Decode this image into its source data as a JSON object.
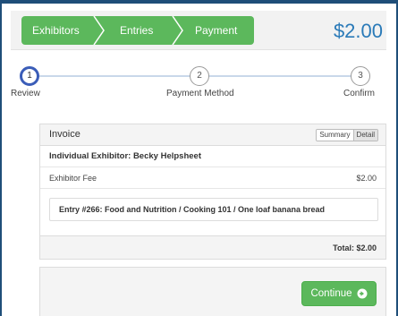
{
  "breadcrumb": {
    "items": [
      "Exhibitors",
      "Entries",
      "Payment"
    ]
  },
  "header": {
    "price": "$2.00"
  },
  "steps": [
    {
      "number": "1",
      "label": "Review",
      "active": true
    },
    {
      "number": "2",
      "label": "Payment Method",
      "active": false
    },
    {
      "number": "3",
      "label": "Confirm",
      "active": false
    }
  ],
  "invoice": {
    "title": "Invoice",
    "toggle": {
      "summary": "Summary",
      "detail": "Detail",
      "selected": "Detail"
    },
    "exhibitor": "Individual Exhibitor: Becky Helpsheet",
    "fee_label": "Exhibitor Fee",
    "fee_amount": "$2.00",
    "entry": "Entry #266: Food and Nutrition / Cooking 101 / One loaf banana bread",
    "total": "Total: $2.00"
  },
  "actions": {
    "continue_label": "Continue",
    "continue_icon": "arrow-circle-right-icon"
  },
  "colors": {
    "accent_green": "#5cb85c",
    "price_blue": "#2a7ab8",
    "active_step": "#3b5db8",
    "frame": "#1f4e79"
  }
}
